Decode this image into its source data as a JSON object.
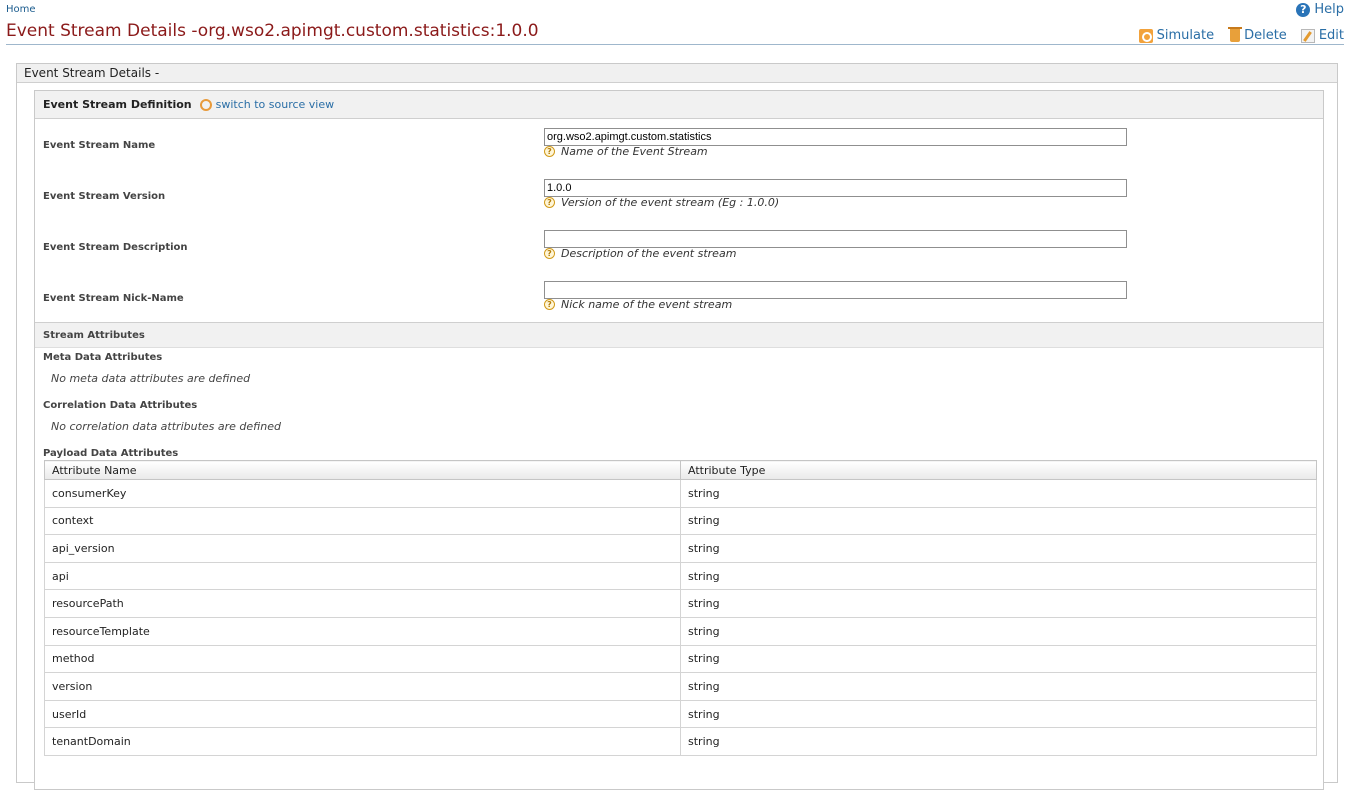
{
  "breadcrumb": "Home",
  "help": "Help",
  "page_title": "Event Stream Details -org.wso2.apimgt.custom.statistics:1.0.0",
  "actions": {
    "simulate": "Simulate",
    "delete": "Delete",
    "edit": "Edit"
  },
  "outer_header": "Event Stream Details -",
  "definition": {
    "title": "Event Stream Definition",
    "switch_link": "switch to source view",
    "fields": [
      {
        "label": "Event Stream Name",
        "value": "org.wso2.apimgt.custom.statistics",
        "hint": "Name of the Event Stream"
      },
      {
        "label": "Event Stream Version",
        "value": "1.0.0",
        "hint": "Version of the event stream (Eg : 1.0.0)"
      },
      {
        "label": "Event Stream Description",
        "value": "",
        "hint": "Description of the event stream"
      },
      {
        "label": "Event Stream Nick-Name",
        "value": "",
        "hint": "Nick name of the event stream"
      }
    ]
  },
  "attributes": {
    "title": "Stream Attributes",
    "meta_label": "Meta Data Attributes",
    "meta_empty": "No meta data attributes are defined",
    "correlation_label": "Correlation Data Attributes",
    "correlation_empty": "No correlation data attributes are defined",
    "payload_label": "Payload Data Attributes",
    "columns": [
      "Attribute Name",
      "Attribute Type"
    ],
    "rows": [
      {
        "name": "consumerKey",
        "type": "string"
      },
      {
        "name": "context",
        "type": "string"
      },
      {
        "name": "api_version",
        "type": "string"
      },
      {
        "name": "api",
        "type": "string"
      },
      {
        "name": "resourcePath",
        "type": "string"
      },
      {
        "name": "resourceTemplate",
        "type": "string"
      },
      {
        "name": "method",
        "type": "string"
      },
      {
        "name": "version",
        "type": "string"
      },
      {
        "name": "userId",
        "type": "string"
      },
      {
        "name": "tenantDomain",
        "type": "string"
      }
    ]
  },
  "colors": {
    "title": "#8b1a1a",
    "link": "#2a6ea6",
    "accent_icon": "#f2a23b"
  },
  "icons": [
    "help-icon",
    "simulate-icon",
    "delete-icon",
    "edit-icon",
    "source-view-icon",
    "help-hint-icon"
  ]
}
